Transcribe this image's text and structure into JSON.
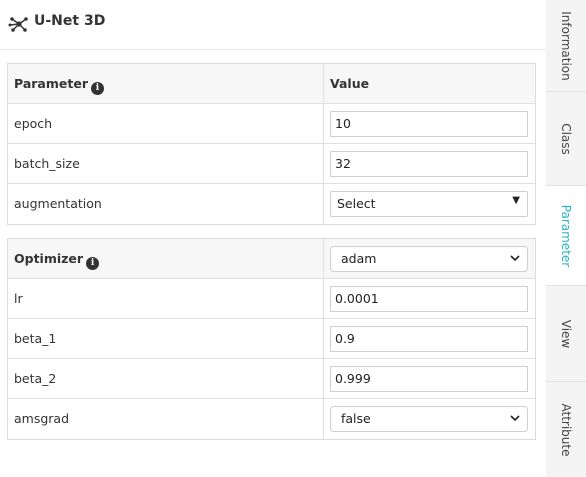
{
  "header": {
    "title": "U-Net 3D",
    "icon": "network-nodes-icon"
  },
  "training": {
    "param_header": "Parameter",
    "value_header": "Value",
    "rows": [
      {
        "label": "epoch",
        "value": "10",
        "type": "input"
      },
      {
        "label": "batch_size",
        "value": "32",
        "type": "input"
      },
      {
        "label": "augmentation",
        "value": "Select",
        "type": "select"
      }
    ]
  },
  "optimizer": {
    "label": "Optimizer",
    "selected": "adam",
    "rows": [
      {
        "label": "lr",
        "value": "0.0001",
        "type": "input"
      },
      {
        "label": "beta_1",
        "value": "0.9",
        "type": "input"
      },
      {
        "label": "beta_2",
        "value": "0.999",
        "type": "input"
      },
      {
        "label": "amsgrad",
        "value": "false",
        "type": "select"
      }
    ]
  },
  "sidebar": {
    "tabs": [
      {
        "label": "Information",
        "active": false
      },
      {
        "label": "Class",
        "active": false
      },
      {
        "label": "Parameter",
        "active": true
      },
      {
        "label": "View",
        "active": false
      },
      {
        "label": "Attribute",
        "active": false
      }
    ]
  },
  "colors": {
    "accent": "#2bb3c0",
    "header_bg": "#f7f7f7",
    "sidebar_bg": "#f4f4f4"
  }
}
